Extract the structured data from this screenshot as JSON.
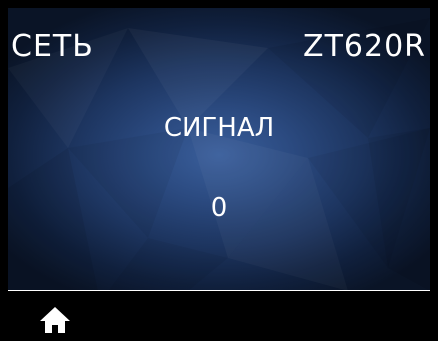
{
  "header": {
    "menu_title": "СЕТЬ",
    "model": "ZT620R"
  },
  "main": {
    "label": "СИГНАЛ",
    "value": "0"
  },
  "footer": {
    "home_icon": "home-icon"
  },
  "colors": {
    "background_center": "#3a5f9c",
    "background_edge": "#0a1426",
    "text": "#ffffff",
    "footer": "#000000"
  }
}
